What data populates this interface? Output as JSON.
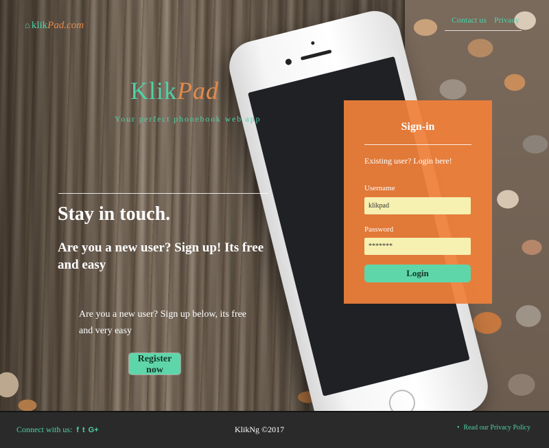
{
  "header": {
    "brand_name": "klik",
    "brand_accent": "Pad",
    "brand_suffix": ".com",
    "nav": {
      "contact": "Contact us",
      "privacy": "Privacy"
    }
  },
  "hero": {
    "logo_name": "Klik",
    "logo_accent": "Pad",
    "tagline": "Your perfect phonebook web app",
    "heading": "Stay in touch.",
    "subheading": "Are you a new user? Sign up! Its free and easy",
    "paragraph": "Are you a new user? Sign up below, its free and very easy",
    "register_button": "Register now"
  },
  "signin": {
    "title": "Sign-in",
    "lead": "Existing user? Login here!",
    "username_label": "Username",
    "username_value": "klikpad",
    "password_label": "Password",
    "password_value": "*******",
    "login_button": "Login"
  },
  "footer": {
    "connect_label": "Connect with us:",
    "social": [
      "f",
      "t",
      "G+"
    ],
    "copyright": "KlikNg ©2017",
    "policy_link": "Read our Privacy Policy"
  },
  "colors": {
    "accent_green": "#4fd1a8",
    "accent_orange": "#e58a4b",
    "panel_orange": "#f0803a",
    "input_yellow": "#f6f0b1",
    "footer_bg": "#2a2a2a"
  }
}
